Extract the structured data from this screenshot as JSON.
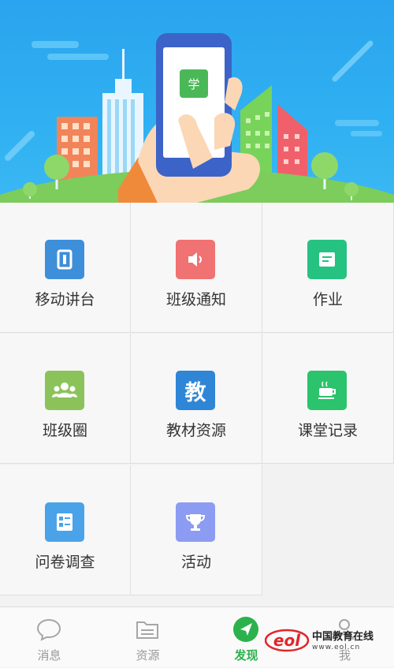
{
  "banner": {
    "app_badge": "学"
  },
  "grid": {
    "items": [
      {
        "label": "移动讲台",
        "icon": "mobile-platform-icon",
        "color": "#3e8fd9"
      },
      {
        "label": "班级通知",
        "icon": "speaker-icon",
        "color": "#f07272"
      },
      {
        "label": "作业",
        "icon": "homework-icon",
        "color": "#26c281"
      },
      {
        "label": "班级圈",
        "icon": "class-circle-icon",
        "color": "#8bc35a"
      },
      {
        "label": "教材资源",
        "icon": "textbook-icon",
        "color": "#2f86d6",
        "glyph": "教"
      },
      {
        "label": "课堂记录",
        "icon": "coffee-cup-icon",
        "color": "#2bc36b"
      },
      {
        "label": "问卷调查",
        "icon": "survey-icon",
        "color": "#4aa3e8"
      },
      {
        "label": "活动",
        "icon": "trophy-icon",
        "color": "#8c9cf2"
      }
    ]
  },
  "tabbar": {
    "tabs": [
      {
        "label": "消息",
        "icon": "chat-bubble-icon"
      },
      {
        "label": "资源",
        "icon": "folder-icon"
      },
      {
        "label": "发现",
        "icon": "compass-icon",
        "active": true
      },
      {
        "label": "我",
        "icon": "person-icon"
      }
    ],
    "active_color": "#2bb24c"
  },
  "watermark": {
    "logo": "eol",
    "name": "中国教育在线",
    "url": "www.eol.cn"
  }
}
